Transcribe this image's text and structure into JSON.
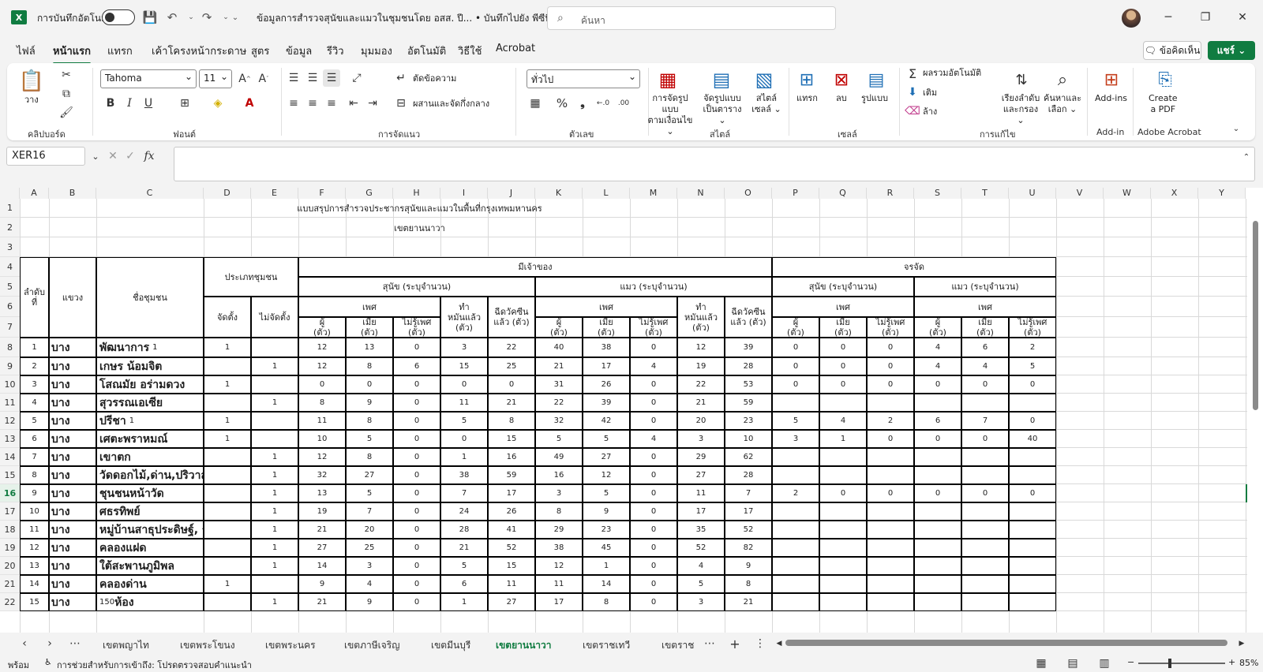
{
  "app": {
    "logo": "X",
    "autosave_label": "การบันทึกอัตโนมัติ",
    "doc_title": "ข้อมูลการสำรวจสุนัขและแมวในชุมชนโดย อสส. ปี...  •  บันทึกไปยัง พีซีนี้ ⌄",
    "search_placeholder": "ค้นหา"
  },
  "menu": [
    "ไฟล์",
    "หน้าแรก",
    "แทรก",
    "เค้าโครงหน้ากระดาษ",
    "สูตร",
    "ข้อมูล",
    "รีวิว",
    "มุมมอง",
    "อัตโนมัติ",
    "วิธีใช้",
    "Acrobat"
  ],
  "menu_active": 1,
  "comment_label": "ข้อคิดเห็น",
  "share_label": "แชร์ ⌄",
  "ribbon": {
    "groups": [
      "คลิปบอร์ด",
      "ฟอนต์",
      "การจัดแนว",
      "ตัวเลข",
      "สไตล์",
      "เซลล์",
      "การแก้ไข",
      "Add-in",
      "Adobe Acrobat"
    ],
    "paste": "วาง",
    "font_name": "Tahoma",
    "font_size": "11",
    "wrap": "ตัดข้อความ",
    "merge": "ผสานและจัดกึ่งกลาง",
    "number_format": "ทั่วไป",
    "cond_fmt": "การจัดรูปแบบ\nตามเงื่อนไข ⌄",
    "table_fmt": "จัดรูปแบบ\nเป็นตาราง ⌄",
    "cell_style": "สไตล์\nเซลล์ ⌄",
    "insert": "แทรก",
    "delete": "ลบ",
    "format": "รูปแบบ",
    "autosum": "ผลรวมอัตโนมัติ",
    "fill": "เติม",
    "clear": "ล้าง",
    "sort": "เรียงลำดับ\nและกรอง ⌄",
    "find": "ค้นหาและ\nเลือก ⌄",
    "addins": "Add-ins",
    "pdf": "Create\na PDF"
  },
  "namebox": "XER16",
  "columns": [
    "A",
    "B",
    "C",
    "D",
    "E",
    "F",
    "G",
    "H",
    "I",
    "J",
    "K",
    "L",
    "M",
    "N",
    "O",
    "P",
    "Q",
    "R",
    "S",
    "T",
    "U",
    "V",
    "W",
    "X",
    "Y"
  ],
  "sheet": {
    "title": "แบบสรุปการสำรวจประชากรสุนัขและแมวในพื้นที่กรุงเทพมหานคร",
    "district": "เขตยานนาวา",
    "h_no": "ลำดับ\nที่",
    "h_khwaeng": "แขวง",
    "h_community": "ชื่อชุมชน",
    "h_type": "ประเภทชุมชน",
    "h_owned": "มีเจ้าของ",
    "h_stray": "จรจัด",
    "h_dog": "สุนัข (ระบุจำนวน)",
    "h_cat": "แมว (ระบุจำนวน)",
    "h_sex": "เพศ",
    "h_neuter": "ทำ\nหมันแล้ว\n(ตัว)",
    "h_vacc": "ฉีดวัคซีน\nแล้ว (ตัว)",
    "h_reg": "จัดตั้ง",
    "h_unreg": "ไม่จัดตั้ง",
    "h_m": "ผู้\n(ตัว)",
    "h_f": "เมีย\n(ตัว)",
    "h_u": "ไม่รู้เพศ\n(ตัว)",
    "rows": [
      {
        "no": "1",
        "k": "บาง",
        "name": "พัฒนาการ",
        "suffix": "1",
        "reg": "1",
        "unreg": "",
        "v": [
          "12",
          "13",
          "0",
          "3",
          "22",
          "40",
          "38",
          "0",
          "12",
          "39",
          "0",
          "0",
          "0",
          "4",
          "6",
          "2"
        ]
      },
      {
        "no": "2",
        "k": "บาง",
        "name": "เกษร น้อมจิต",
        "suffix": "",
        "reg": "",
        "unreg": "1",
        "v": [
          "12",
          "8",
          "6",
          "15",
          "25",
          "21",
          "17",
          "4",
          "19",
          "28",
          "0",
          "0",
          "0",
          "4",
          "4",
          "5"
        ]
      },
      {
        "no": "3",
        "k": "บาง",
        "name": "โสณมัย อร่ามดวง",
        "suffix": "",
        "reg": "1",
        "unreg": "",
        "v": [
          "0",
          "0",
          "0",
          "0",
          "0",
          "31",
          "26",
          "0",
          "22",
          "53",
          "0",
          "0",
          "0",
          "0",
          "0",
          "0"
        ]
      },
      {
        "no": "4",
        "k": "บาง",
        "name": "สุวรรณเอเซีย",
        "suffix": "",
        "reg": "",
        "unreg": "1",
        "v": [
          "8",
          "9",
          "0",
          "11",
          "21",
          "22",
          "39",
          "0",
          "21",
          "59",
          "",
          "",
          "",
          "",
          "",
          ""
        ]
      },
      {
        "no": "5",
        "k": "บาง",
        "name": "ปรีชา",
        "suffix": "1",
        "reg": "1",
        "unreg": "",
        "v": [
          "11",
          "8",
          "0",
          "5",
          "8",
          "32",
          "42",
          "0",
          "20",
          "23",
          "5",
          "4",
          "2",
          "6",
          "7",
          "0"
        ]
      },
      {
        "no": "6",
        "k": "บาง",
        "name": "เศตะพราหมณ์",
        "suffix": "",
        "reg": "1",
        "unreg": "",
        "v": [
          "10",
          "5",
          "0",
          "0",
          "15",
          "5",
          "5",
          "4",
          "3",
          "10",
          "3",
          "1",
          "0",
          "0",
          "0",
          "40"
        ]
      },
      {
        "no": "7",
        "k": "บาง",
        "name": "เขาตก",
        "suffix": "",
        "reg": "",
        "unreg": "1",
        "v": [
          "12",
          "8",
          "0",
          "1",
          "16",
          "49",
          "27",
          "0",
          "29",
          "62",
          "",
          "",
          "",
          "",
          "",
          ""
        ]
      },
      {
        "no": "8",
        "k": "บาง",
        "name": "วัดดอกไม้,ด่าน,ปริวาส,ทองบน",
        "suffix": "",
        "reg": "",
        "unreg": "1",
        "v": [
          "32",
          "27",
          "0",
          "38",
          "59",
          "16",
          "12",
          "0",
          "27",
          "28",
          "",
          "",
          "",
          "",
          "",
          ""
        ]
      },
      {
        "no": "9",
        "k": "บาง",
        "name": "ชุนชนหน้าวัด",
        "suffix": "",
        "reg": "",
        "unreg": "1",
        "v": [
          "13",
          "5",
          "0",
          "7",
          "17",
          "3",
          "5",
          "0",
          "11",
          "7",
          "2",
          "0",
          "0",
          "0",
          "0",
          "0"
        ]
      },
      {
        "no": "10",
        "k": "บาง",
        "name": "ศธรทิพย์",
        "suffix": "",
        "reg": "",
        "unreg": "1",
        "v": [
          "19",
          "7",
          "0",
          "24",
          "26",
          "8",
          "9",
          "0",
          "17",
          "17",
          "",
          "",
          "",
          "",
          "",
          ""
        ]
      },
      {
        "no": "11",
        "k": "บาง",
        "name": "หมู่บ้านสาธุประดิษฐ์, ร่มเย็น",
        "suffix": "",
        "reg": "",
        "unreg": "1",
        "v": [
          "21",
          "20",
          "0",
          "28",
          "41",
          "29",
          "23",
          "0",
          "35",
          "52",
          "",
          "",
          "",
          "",
          "",
          ""
        ]
      },
      {
        "no": "12",
        "k": "บาง",
        "name": "คลองแฝด",
        "suffix": "",
        "reg": "",
        "unreg": "1",
        "v": [
          "27",
          "25",
          "0",
          "21",
          "52",
          "38",
          "45",
          "0",
          "52",
          "82",
          "",
          "",
          "",
          "",
          "",
          ""
        ]
      },
      {
        "no": "13",
        "k": "บาง",
        "name": "ใต้สะพานภูมิพล",
        "suffix": "",
        "reg": "",
        "unreg": "1",
        "v": [
          "14",
          "3",
          "0",
          "5",
          "15",
          "12",
          "1",
          "0",
          "4",
          "9",
          "",
          "",
          "",
          "",
          "",
          ""
        ]
      },
      {
        "no": "14",
        "k": "บาง",
        "name": "คลองด่าน",
        "suffix": "",
        "reg": "1",
        "unreg": "",
        "v": [
          "9",
          "4",
          "0",
          "6",
          "11",
          "11",
          "14",
          "0",
          "5",
          "8",
          "",
          "",
          "",
          "",
          "",
          ""
        ]
      },
      {
        "no": "15",
        "k": "บาง",
        "name": "ห้อง",
        "prefix": "150",
        "suffix": "",
        "reg": "",
        "unreg": "1",
        "v": [
          "21",
          "9",
          "0",
          "1",
          "27",
          "17",
          "8",
          "0",
          "3",
          "21",
          "",
          "",
          "",
          "",
          "",
          ""
        ]
      }
    ]
  },
  "tabs": [
    "เขตพญาไท",
    "เขตพระโขนง",
    "เขตพระนคร",
    "เขตภาษีเจริญ",
    "เขตมีนบุรี",
    "เขตยานนาวา",
    "เขตราชเทวี",
    "เขตราช"
  ],
  "tab_active": 5,
  "status": {
    "ready": "พร้อม",
    "accessibility": "การช่วยสำหรับการเข้าถึง: โปรดตรวจสอบคำแนะนำ",
    "zoom": "85%"
  }
}
